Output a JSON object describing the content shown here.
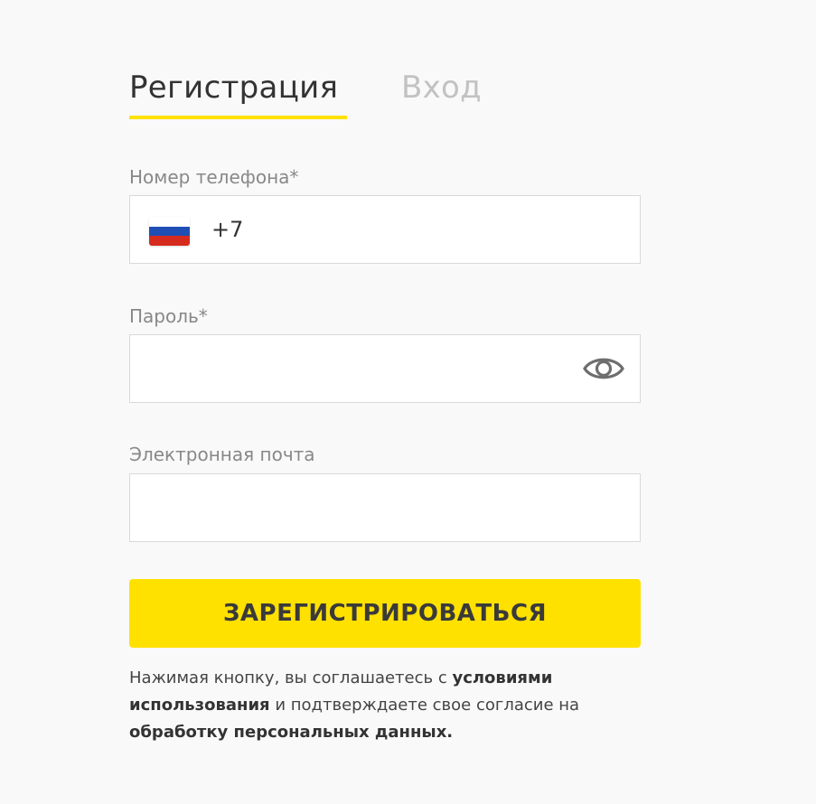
{
  "tabs": {
    "register": "Регистрация",
    "login": "Вход"
  },
  "phone": {
    "label": "Номер телефона*",
    "value": "+7",
    "flag": "russia-flag-icon"
  },
  "password": {
    "label": "Пароль*",
    "value": "",
    "toggle_icon": "eye-icon"
  },
  "email": {
    "label": "Электронная почта",
    "value": ""
  },
  "submit_label": "ЗАРЕГИСТРИРОВАТЬСЯ",
  "terms": {
    "prefix": "Нажимая кнопку, вы соглашаетесь с",
    "terms_link": "условиями использования",
    "middle": "и подтверждаете свое согласие на",
    "privacy_link": "обработку персональных данных."
  },
  "colors": {
    "accent": "#ffe100",
    "background": "#f9f9f9",
    "inactive_tab": "#c2c2c2",
    "label": "#888888",
    "flag_white": "#ffffff",
    "flag_blue": "#1f4fb4",
    "flag_red": "#d52b1e"
  }
}
